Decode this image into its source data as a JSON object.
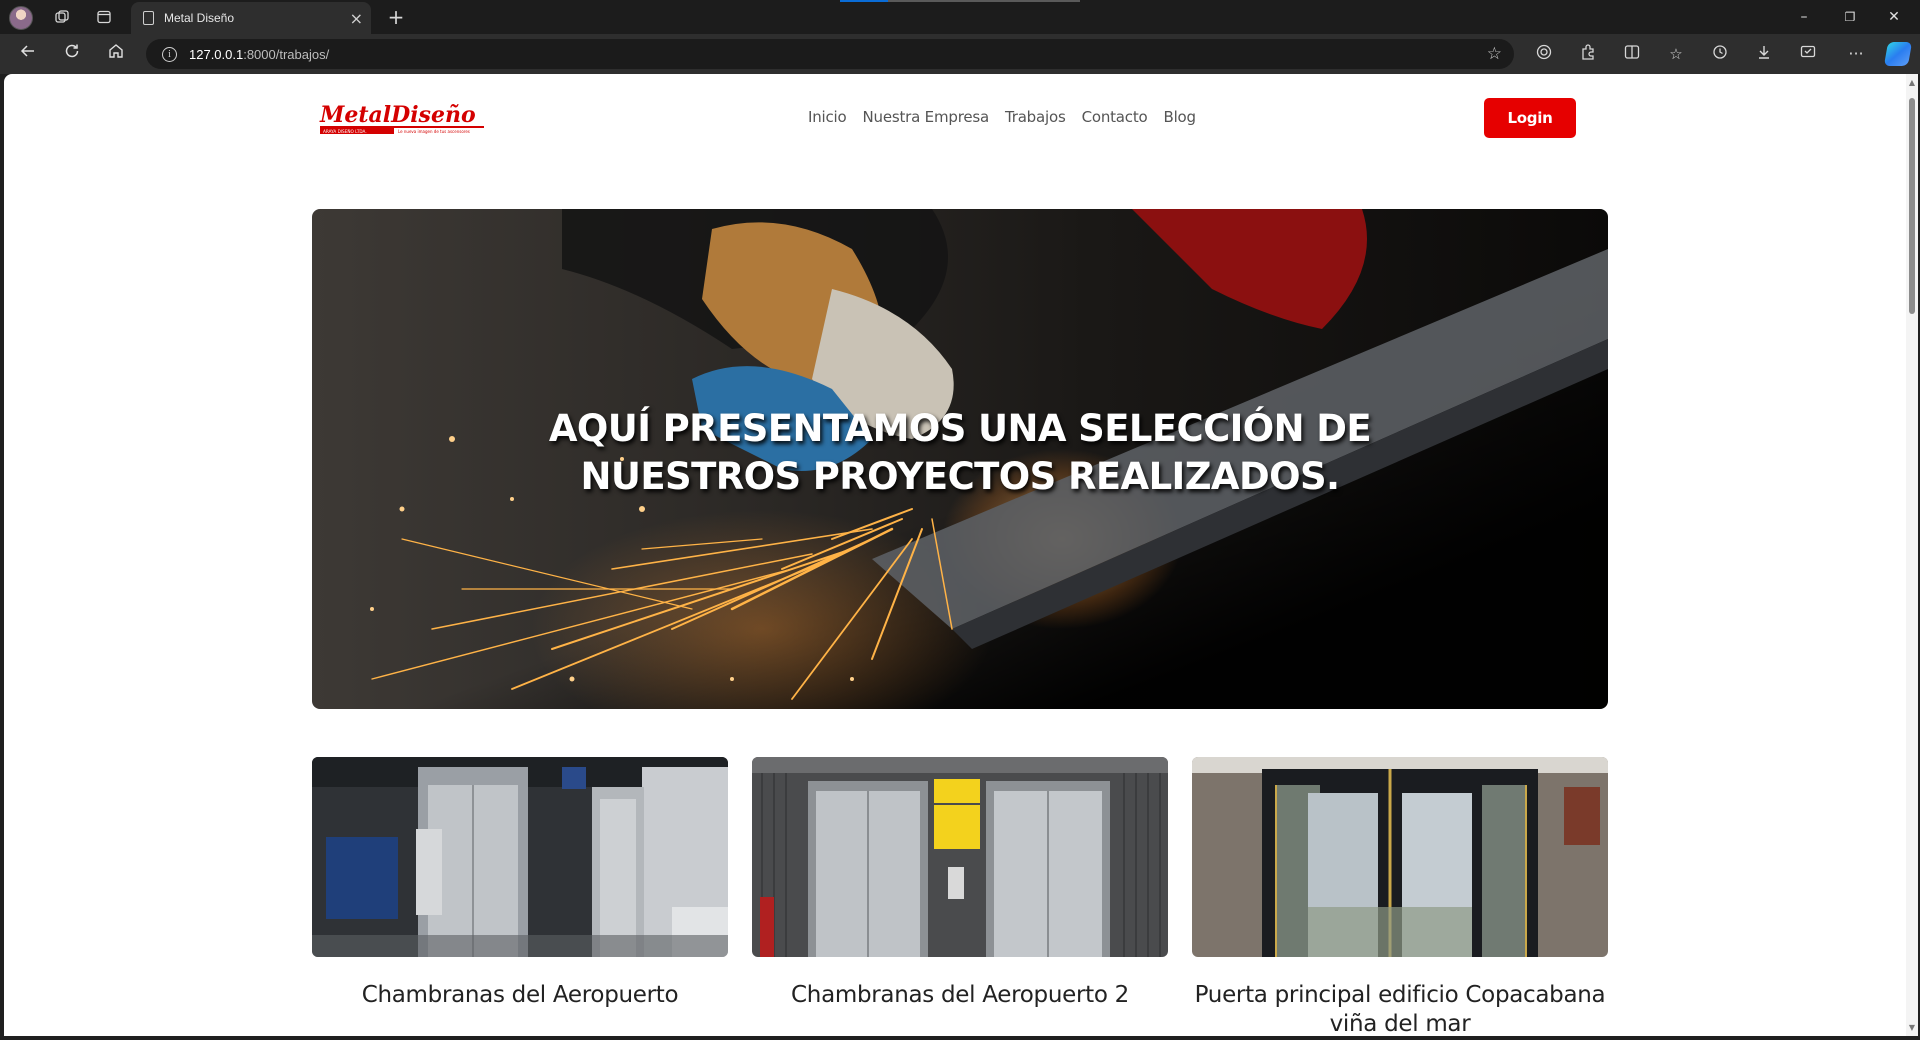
{
  "browser": {
    "tab_title": "Metal Diseño",
    "url_host": "127.0.0.1",
    "url_path": ":8000/trabajos/",
    "tab_close_glyph": "×",
    "new_tab_glyph": "+",
    "window_controls": [
      "–",
      "❐",
      "✕"
    ]
  },
  "site": {
    "logo": {
      "brand": "MetalDiseño",
      "tagline": "Le nueva imagen de tus ascensores",
      "sub": "ARAYA DISEÑO LTDA."
    },
    "nav": [
      "Inicio",
      "Nuestra Empresa",
      "Trabajos",
      "Contacto",
      "Blog"
    ],
    "login_label": "Login"
  },
  "hero": {
    "title_line1": "AQUÍ PRESENTAMOS UNA SELECCIÓN DE",
    "title_line2": "NUESTROS PROYECTOS REALIZADOS."
  },
  "projects": [
    {
      "title": "Chambranas del Aeropuerto"
    },
    {
      "title": "Chambranas del Aeropuerto 2"
    },
    {
      "title": "Puerta principal edificio Copacabana viña del mar"
    }
  ],
  "colors": {
    "accent": "#e60000",
    "nav_text": "#555555",
    "caption_text": "#222222"
  },
  "icons": [
    "profile-avatar",
    "workspaces-icon",
    "tab-actions-icon",
    "page-icon",
    "back-icon",
    "refresh-icon",
    "home-icon",
    "info-icon",
    "favorite-star-icon",
    "browser-essentials-icon",
    "extensions-icon",
    "split-screen-icon",
    "favorites-icon",
    "history-icon",
    "downloads-icon",
    "screenshot-icon",
    "more-icon",
    "copilot-icon"
  ]
}
